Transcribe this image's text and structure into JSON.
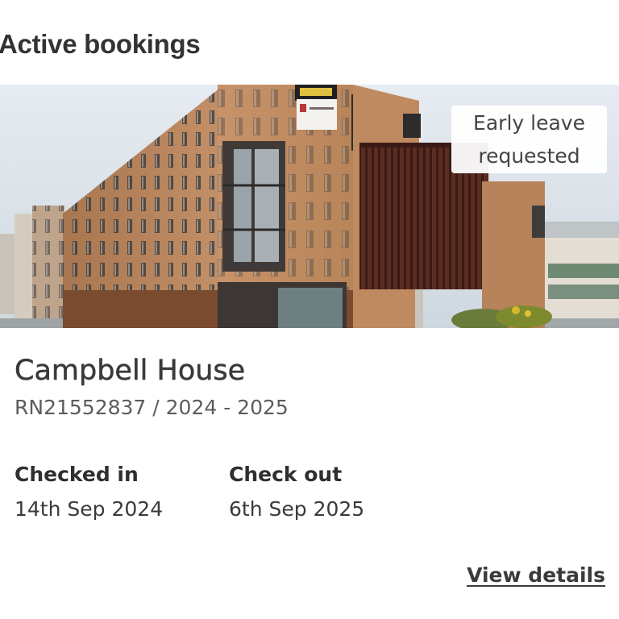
{
  "section": {
    "title": "Active bookings"
  },
  "booking": {
    "image_alt": "Campbell House building",
    "status_badge": "Early leave\nrequested",
    "property_name": "Campbell House",
    "reference": "RN21552837 / 2024 - 2025",
    "checked_in_label": "Checked in",
    "checked_in_date": "14th Sep 2024",
    "check_out_label": "Check out",
    "check_out_date": "6th Sep 2025",
    "view_details_label": "View details"
  },
  "colors": {
    "text": "#333333",
    "brick": "#b8855e",
    "cladding": "#5a2a20",
    "sky": "#dfe7ee"
  }
}
